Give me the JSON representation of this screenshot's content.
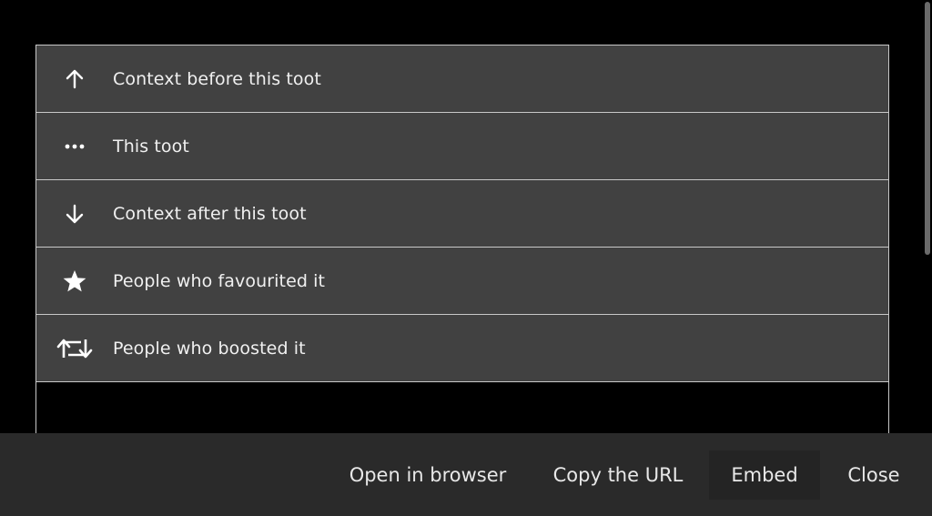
{
  "menu": {
    "items": [
      {
        "label": "Context before this toot",
        "icon": "arrow-up-icon"
      },
      {
        "label": "This toot",
        "icon": "more-dots-icon"
      },
      {
        "label": "Context after this toot",
        "icon": "arrow-down-icon"
      },
      {
        "label": "People who favourited it",
        "icon": "star-icon"
      },
      {
        "label": "People who boosted it",
        "icon": "boost-icon"
      }
    ]
  },
  "footer": {
    "open_browser": "Open in browser",
    "copy_url": "Copy the URL",
    "embed": "Embed",
    "close": "Close"
  },
  "colors": {
    "background": "#000000",
    "item_background": "#414141",
    "item_border": "#c8c8c8",
    "footer_background": "#2a2a2a",
    "text": "#f0f0f0"
  }
}
